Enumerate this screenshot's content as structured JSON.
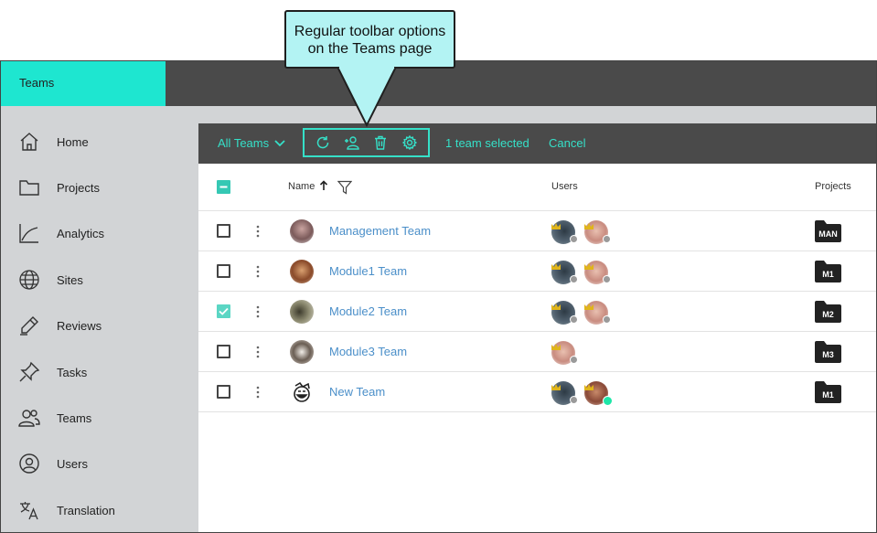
{
  "callout": {
    "line1": "Regular toolbar options",
    "line2": "on the Teams page"
  },
  "app": {
    "brand": "Teams"
  },
  "sidebar": {
    "items": [
      {
        "label": "Home",
        "icon": "home-icon"
      },
      {
        "label": "Projects",
        "icon": "folder-icon"
      },
      {
        "label": "Analytics",
        "icon": "chart-icon"
      },
      {
        "label": "Sites",
        "icon": "globe-icon"
      },
      {
        "label": "Reviews",
        "icon": "pencil-icon"
      },
      {
        "label": "Tasks",
        "icon": "pin-icon"
      },
      {
        "label": "Teams",
        "icon": "people-icon"
      },
      {
        "label": "Users",
        "icon": "user-circle-icon"
      },
      {
        "label": "Translation",
        "icon": "translate-icon"
      }
    ]
  },
  "toolbar": {
    "dropdown_label": "All Teams",
    "actions": [
      {
        "icon": "refresh-icon"
      },
      {
        "icon": "add-user-icon"
      },
      {
        "icon": "trash-icon"
      },
      {
        "icon": "settings-gear-icon"
      }
    ],
    "selected_text": "1 team selected",
    "cancel_label": "Cancel",
    "accent_color": "#35e0c8"
  },
  "table": {
    "headers": {
      "name": "Name",
      "users": "Users",
      "projects": "Projects"
    },
    "rows": [
      {
        "name": "Management Team",
        "checked": false,
        "project": "MAN",
        "users": 2
      },
      {
        "name": "Module1 Team",
        "checked": false,
        "project": "M1",
        "users": 2
      },
      {
        "name": "Module2 Team",
        "checked": true,
        "project": "M2",
        "users": 2
      },
      {
        "name": "Module3 Team",
        "checked": false,
        "project": "M3",
        "users": 1
      },
      {
        "name": "New Team",
        "checked": false,
        "project": "M1",
        "users": 2
      }
    ]
  },
  "colors": {
    "brand": "#1ee6d0",
    "topbar": "#4a4a4a",
    "sidebar": "#d2d4d6",
    "link": "#4b8fc9",
    "callout": "#b3f3f3"
  }
}
